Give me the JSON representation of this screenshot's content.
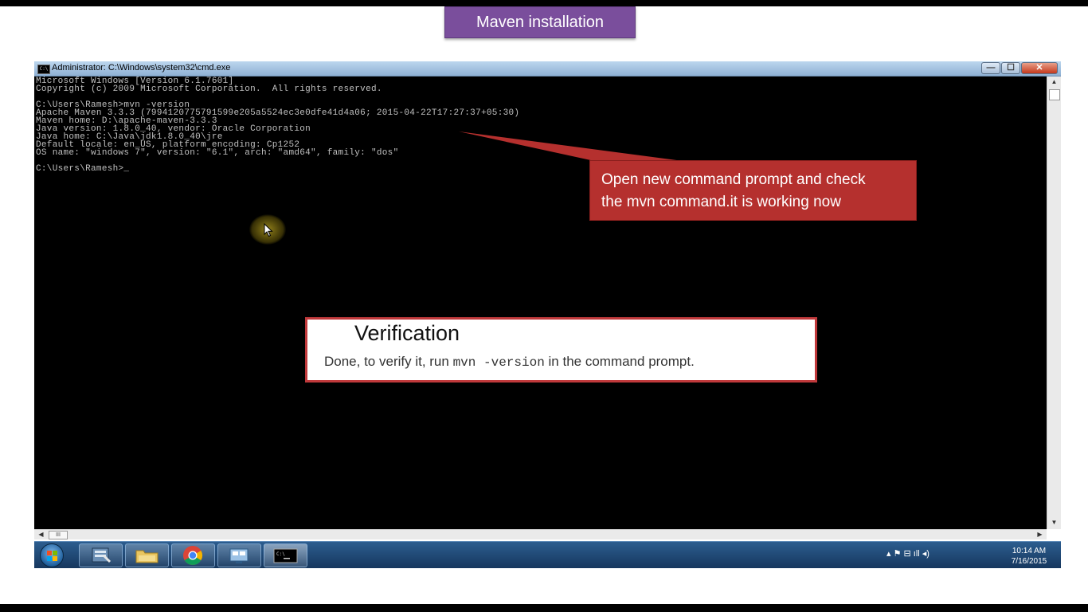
{
  "slide": {
    "title": "Maven installation"
  },
  "cmd_window": {
    "title": "Administrator: C:\\Windows\\system32\\cmd.exe",
    "icon_label": "C:\\",
    "buttons": {
      "minimize": "—",
      "maximize": "☐",
      "close": "✕"
    },
    "console_lines": [
      "Microsoft Windows [Version 6.1.7601]",
      "Copyright (c) 2009 Microsoft Corporation.  All rights reserved.",
      "",
      "C:\\Users\\Ramesh>mvn -version",
      "Apache Maven 3.3.3 (7994120775791599e205a5524ec3e0dfe41d4a06; 2015-04-22T17:27:37+05:30)",
      "Maven home: D:\\apache-maven-3.3.3",
      "Java version: 1.8.0_40, vendor: Oracle Corporation",
      "Java home: C:\\Java\\jdk1.8.0_40\\jre",
      "Default locale: en_US, platform encoding: Cp1252",
      "OS name: \"windows 7\", version: \"6.1\", arch: \"amd64\", family: \"dos\"",
      "",
      "C:\\Users\\Ramesh>_"
    ],
    "hscroll_thumb": "III"
  },
  "callout": {
    "line1": "Open new command prompt and check",
    "line2": "the mvn command.it is working now",
    "color": "#b5302e"
  },
  "verification": {
    "title": "Verification",
    "text_before": "Done, to verify it, run ",
    "code": "mvn -version",
    "text_after": " in the command prompt.",
    "border_color": "#c0393b"
  },
  "taskbar": {
    "icons": [
      "windows-start-icon",
      "server-manager-icon",
      "file-explorer-icon",
      "chrome-icon",
      "control-panel-icon",
      "command-prompt-icon"
    ],
    "tray_symbols": "▴   ⚑  ⊟  ıll  ◂)",
    "time": "10:14 AM",
    "date": "7/16/2015"
  }
}
